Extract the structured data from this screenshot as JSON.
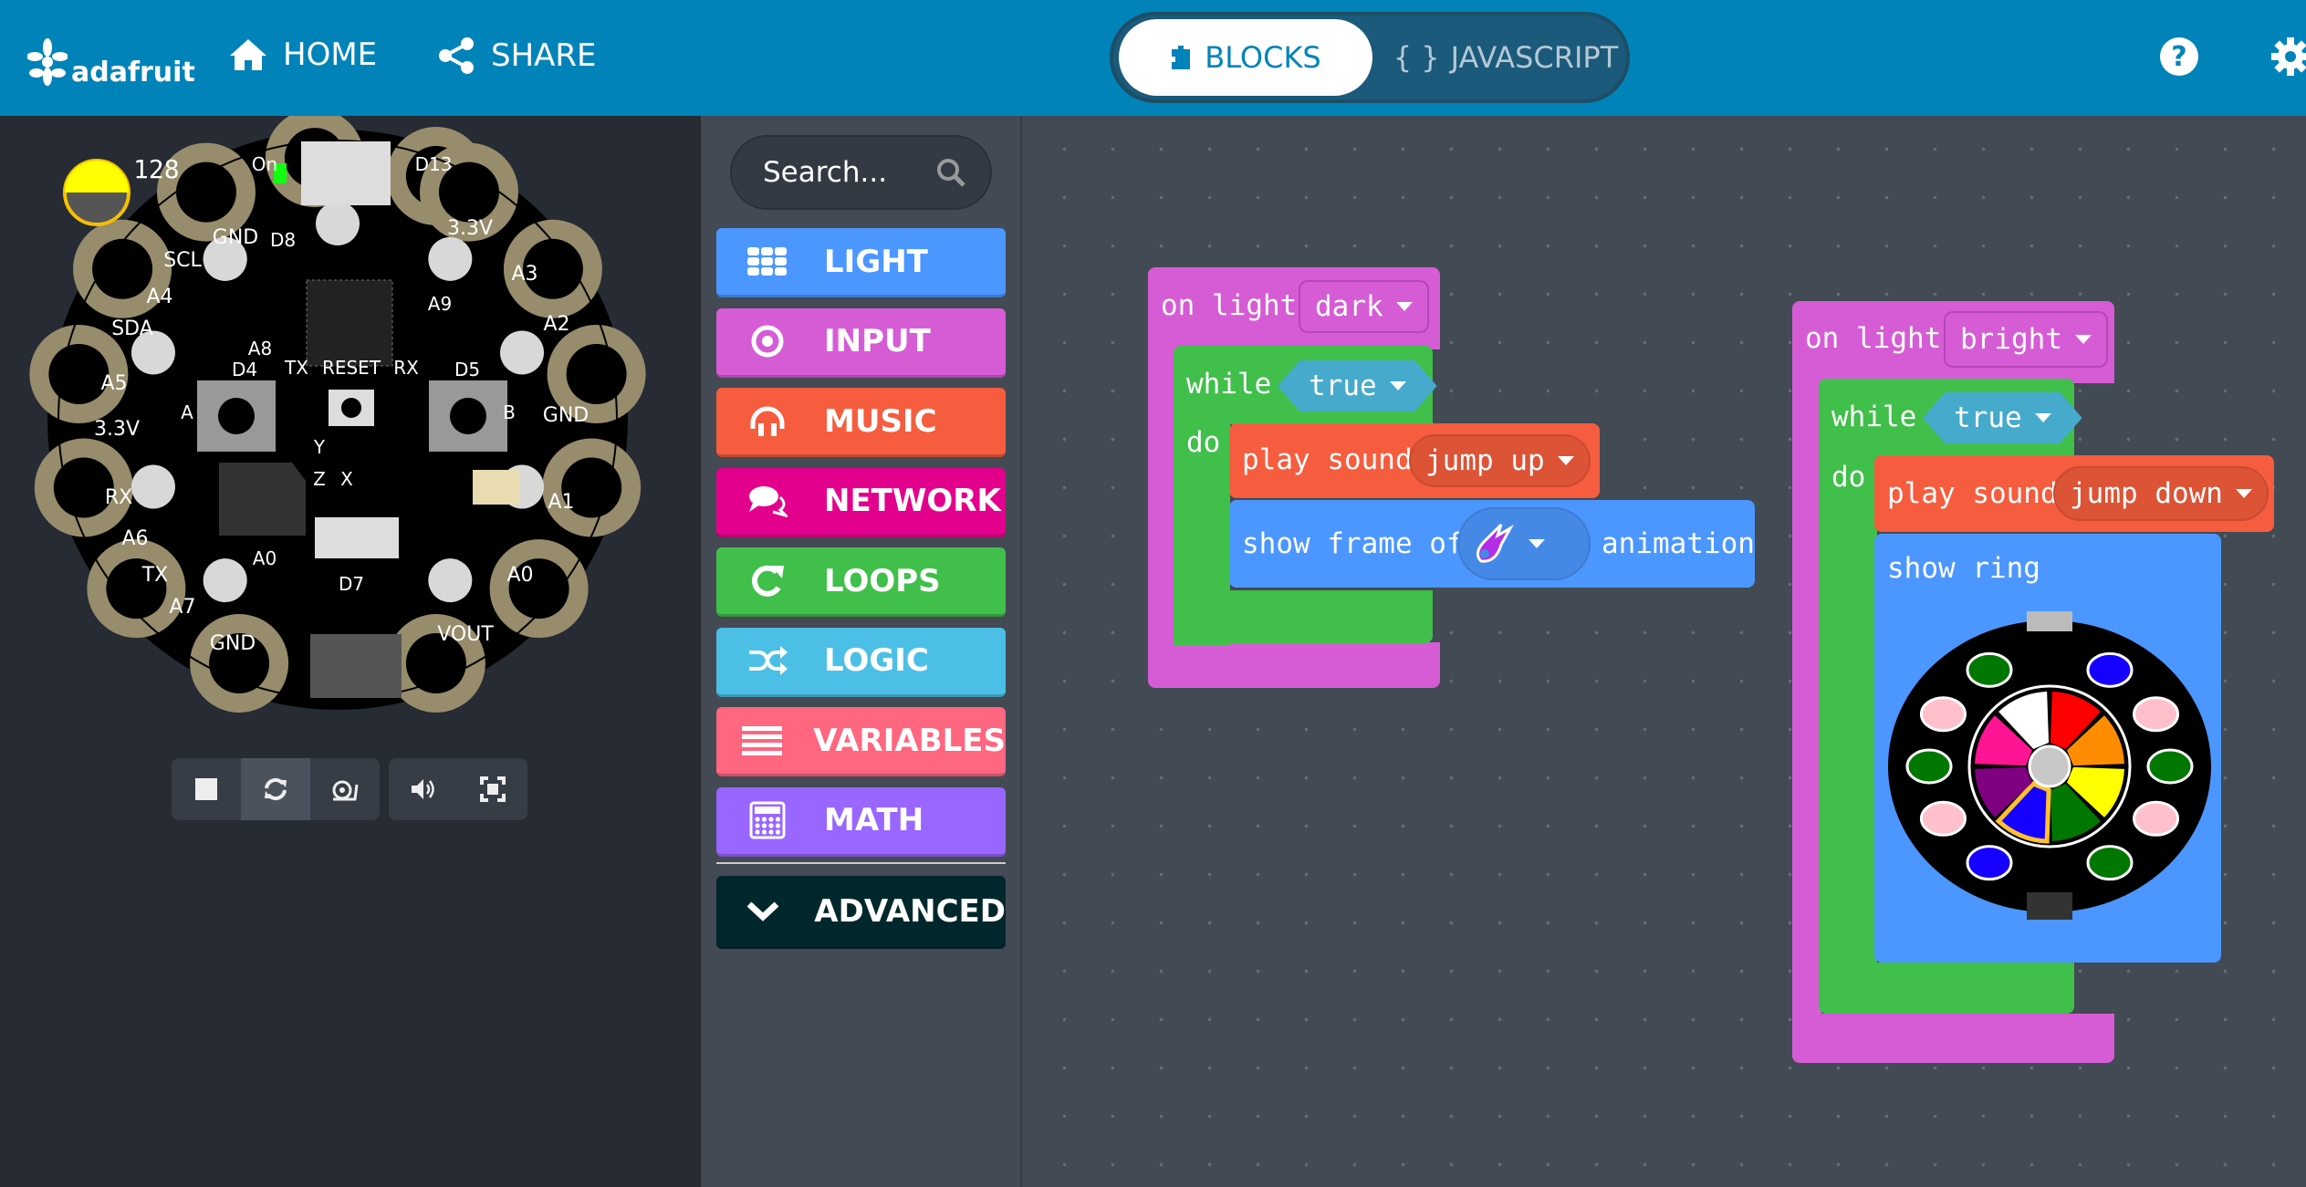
{
  "header": {
    "logo": "adafruit",
    "home_label": "HOME",
    "share_label": "SHARE",
    "tabs": [
      {
        "label": "BLOCKS",
        "active": true
      },
      {
        "label": "JAVASCRIPT",
        "icon_text": "{ }",
        "active": false
      }
    ],
    "help_icon": "question-circle-icon",
    "settings_icon": "gear-icon",
    "color": "#0083b9"
  },
  "simulator": {
    "light_level": "128",
    "pin_labels": [
      "GND",
      "SCL",
      "A4",
      "SDA",
      "A5",
      "3.3V",
      "RX",
      "A6",
      "TX",
      "A7",
      "GND",
      "VOUT",
      "A0",
      "A1",
      "GND",
      "A2",
      "A3",
      "3.3V",
      "D13",
      "On",
      "D8",
      "A8",
      "A9",
      "D4",
      "TX",
      "RESET",
      "RX",
      "D5",
      "A0",
      "D7",
      "A",
      "B",
      "Y",
      "Z",
      "X"
    ],
    "controls": [
      "stop-icon",
      "restart-icon",
      "slow-motion-icon",
      "sound-icon",
      "fullscreen-icon"
    ]
  },
  "toolbox": {
    "search_placeholder": "Search...",
    "categories": [
      {
        "label": "LIGHT",
        "color": "#4c97ff",
        "icon": "grid-icon"
      },
      {
        "label": "INPUT",
        "color": "#d65cd6",
        "icon": "target-icon"
      },
      {
        "label": "MUSIC",
        "color": "#f55d3e",
        "icon": "headphones-icon"
      },
      {
        "label": "NETWORK",
        "color": "#e3008c",
        "icon": "chat-icon"
      },
      {
        "label": "LOOPS",
        "color": "#40bf4a",
        "icon": "loop-icon"
      },
      {
        "label": "LOGIC",
        "color": "#4cbfe6",
        "icon": "shuffle-icon"
      },
      {
        "label": "VARIABLES",
        "color": "#ff6680",
        "icon": "list-icon"
      },
      {
        "label": "MATH",
        "color": "#9966ff",
        "icon": "calculator-icon"
      }
    ],
    "advanced": {
      "label": "ADVANCED",
      "color": "#00272b",
      "icon": "chevron-down-icon"
    }
  },
  "workspace": {
    "block1": {
      "event": "on light",
      "condition": "dark",
      "loop": "while",
      "loop_value": "true",
      "do": "do",
      "sound_text": "play sound",
      "sound": "jump up",
      "frame_text": "show frame of",
      "frame_suffix": "animation",
      "frame_icon": "comet-icon"
    },
    "block2": {
      "event": "on light",
      "condition": "bright",
      "loop": "while",
      "loop_value": "true",
      "do": "do",
      "sound_text": "play sound",
      "sound": "jump down",
      "ring_text": "show ring",
      "ring_leds": [
        "#007700",
        "#1500ff",
        "#ffc0cb",
        "#007700",
        "#ffc0cb",
        "#007700",
        "#1500ff",
        "#ffc0cb",
        "#007700",
        "#ffc0cb"
      ],
      "wheel_colors": [
        "#ff0000",
        "#ff8c00",
        "#ffff00",
        "#007700",
        "#1500ff",
        "#7f007f",
        "#ff1493",
        "#ffffff"
      ],
      "selected_color": "#1500ff"
    }
  }
}
